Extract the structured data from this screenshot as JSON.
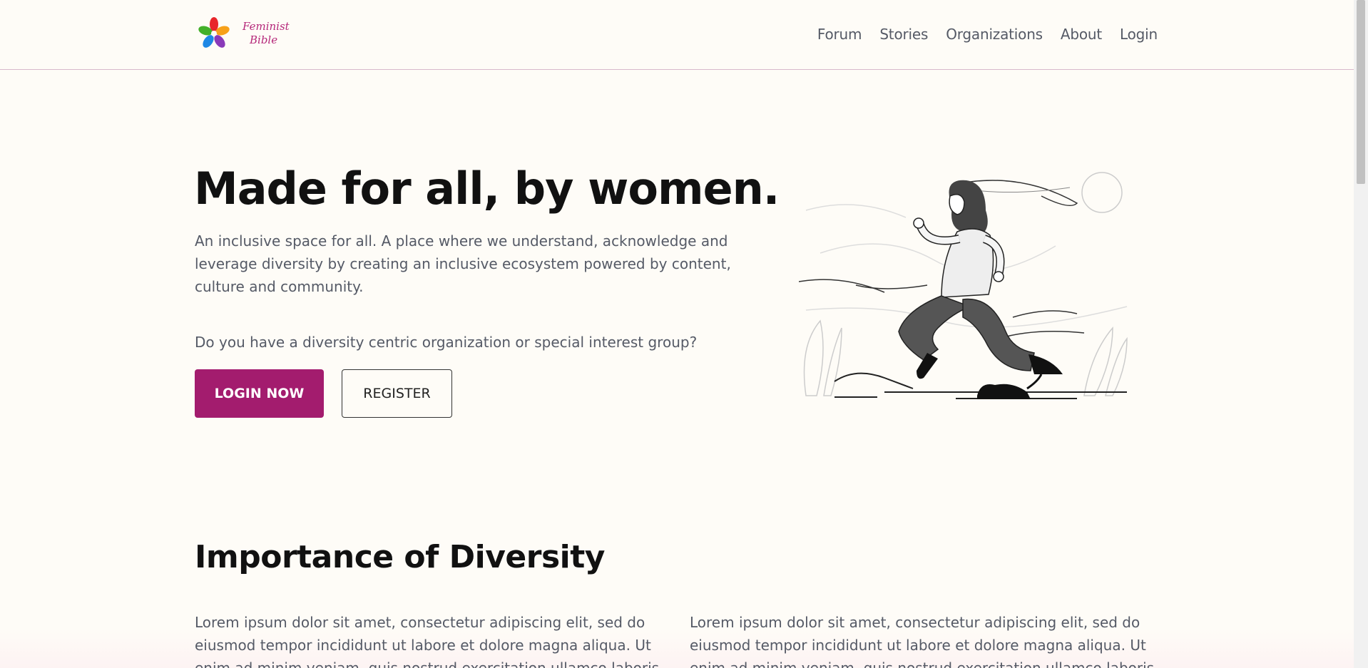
{
  "nav": {
    "logo_text_1": "Feminist",
    "logo_text_2": "Bible",
    "links": [
      "Forum",
      "Stories",
      "Organizations",
      "About",
      "Login"
    ]
  },
  "hero": {
    "title": "Made for all, by women.",
    "description": "An inclusive space for all. A place where we understand, acknowledge and leverage diversity by creating an inclusive ecosystem powered by content, culture and community.",
    "question": "Do you have a diversity centric organization or special interest group?",
    "login_button": "LOGIN NOW",
    "register_button": "REGISTER"
  },
  "importance": {
    "title": "Importance of Diversity",
    "col1": "Lorem ipsum dolor sit amet, consectetur adipiscing elit, sed do eiusmod tempor incididunt ut labore et dolore magna aliqua. Ut enim ad minim veniam, quis nostrud exercitation ullamco laboris",
    "col2": "Lorem ipsum dolor sit amet, consectetur adipiscing elit, sed do eiusmod tempor incididunt ut labore et dolore magna aliqua. Ut enim ad minim veniam, quis nostrud exercitation ullamco laboris"
  },
  "colors": {
    "accent": "#a31c6e",
    "background": "#fefcf7",
    "text_muted": "#555a66"
  },
  "icons": {
    "logo": "colorful-hands-icon",
    "illustration": "running-woman-illustration"
  }
}
